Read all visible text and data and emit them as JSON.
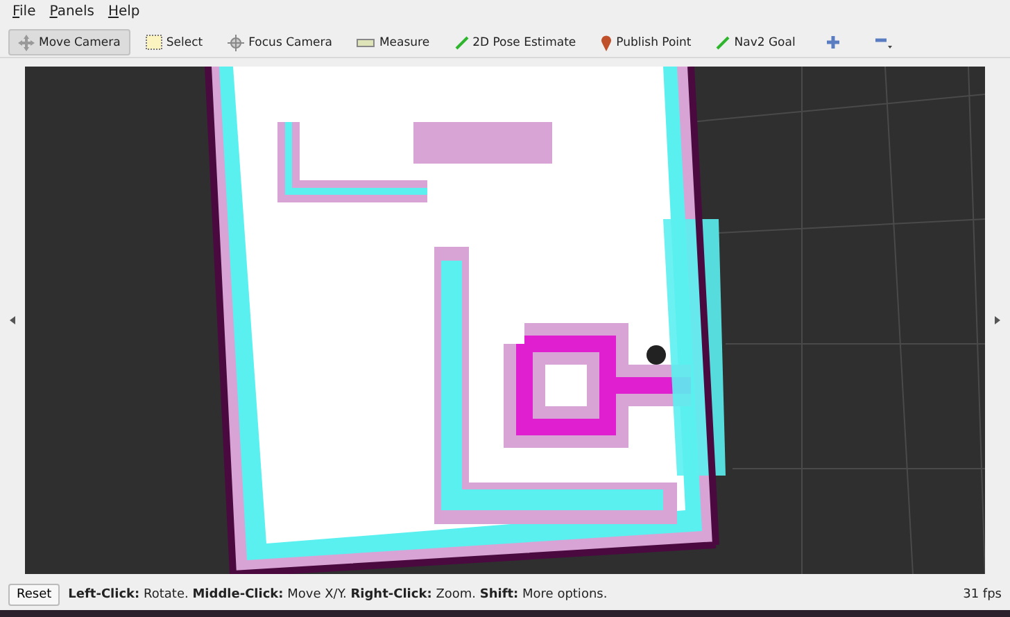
{
  "menu": [
    "File",
    "Panels",
    "Help"
  ],
  "tools": [
    {
      "label": "Move Camera",
      "kind": "move",
      "selected": true
    },
    {
      "label": "Select",
      "kind": "select",
      "selected": false
    },
    {
      "label": "Focus Camera",
      "kind": "focus",
      "selected": false
    },
    {
      "label": "Measure",
      "kind": "measure",
      "selected": false
    },
    {
      "label": "2D Pose Estimate",
      "kind": "pose",
      "selected": false
    },
    {
      "label": "Publish Point",
      "kind": "point",
      "selected": false
    },
    {
      "label": "Nav2 Goal",
      "kind": "goal",
      "selected": false
    }
  ],
  "status_bar": {
    "button": "Reset",
    "hint": "**Left-Click:** Rotate. **Middle-Click:** Move X/Y. **Right-Click:** Zoom. **Shift:** More options.",
    "fps": "31 fps"
  }
}
